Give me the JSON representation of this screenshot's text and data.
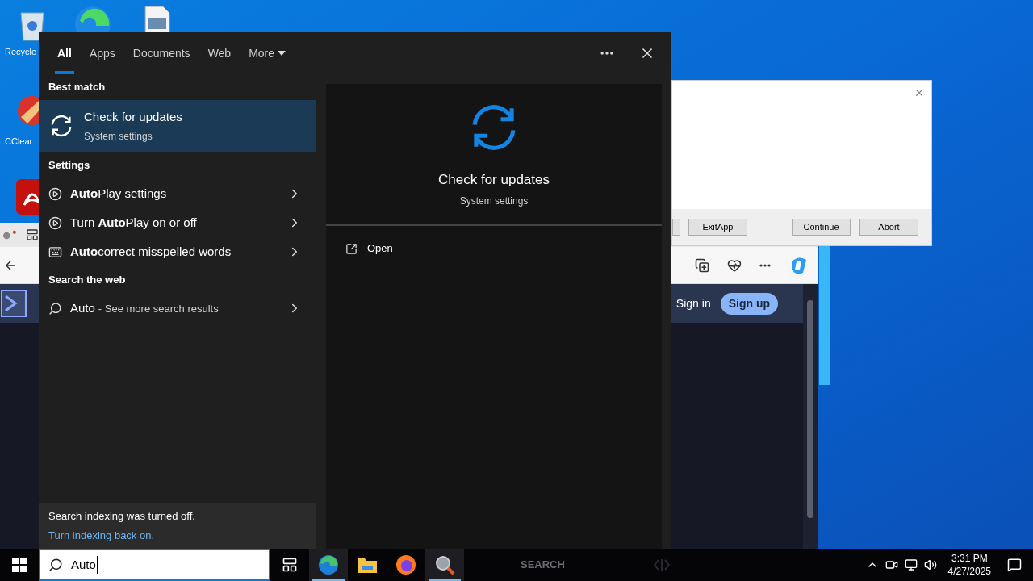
{
  "desktop_icons": [
    {
      "kind": "recycle",
      "label": "Recycle"
    },
    {
      "kind": "browser"
    },
    {
      "kind": "file"
    },
    {
      "kind": "cleaner",
      "label": "CClear"
    },
    {
      "kind": "pdf"
    }
  ],
  "dialog": {
    "buttons": [
      "ExitApp",
      "Continue",
      "Abort"
    ]
  },
  "browser": {
    "sign_in": "Sign in",
    "sign_up": "Sign up"
  },
  "search_panel": {
    "tabs": [
      {
        "label": "All",
        "selected": true
      },
      {
        "label": "Apps",
        "selected": false
      },
      {
        "label": "Documents",
        "selected": false
      },
      {
        "label": "Web",
        "selected": false
      },
      {
        "label": "More",
        "selected": false
      }
    ],
    "best_match_heading": "Best match",
    "best_match": {
      "title": "Check for updates",
      "subtitle": "System settings",
      "selected": true
    },
    "sections": [
      {
        "heading": "Settings",
        "items": [
          {
            "kind": "autoplay",
            "text": "**Auto**Play settings"
          },
          {
            "kind": "autoplay",
            "text": "Turn **Auto**Play on or off"
          },
          {
            "kind": "keyboard",
            "text": "**Auto**correct misspelled words"
          }
        ]
      },
      {
        "heading": "Search the web",
        "items": [
          {
            "kind": "web",
            "text": "Auto",
            "suffix": "- See more search results"
          }
        ]
      }
    ],
    "notice": {
      "text": "Search indexing was turned off.",
      "link": "Turn indexing back on."
    },
    "preview": {
      "title": "Check for updates",
      "subtitle": "System settings",
      "action": "Open"
    }
  },
  "taskbar": {
    "search_value": "Auto",
    "faint_label": "SEARCH",
    "time": "3:31 PM",
    "date": "4/27/2025",
    "apps": [
      {
        "kind": "taskview",
        "active": false
      },
      {
        "kind": "edge",
        "active": true
      },
      {
        "kind": "folder",
        "active": false
      },
      {
        "kind": "firefox",
        "active": false
      },
      {
        "kind": "magnifier",
        "active": true
      }
    ]
  }
}
